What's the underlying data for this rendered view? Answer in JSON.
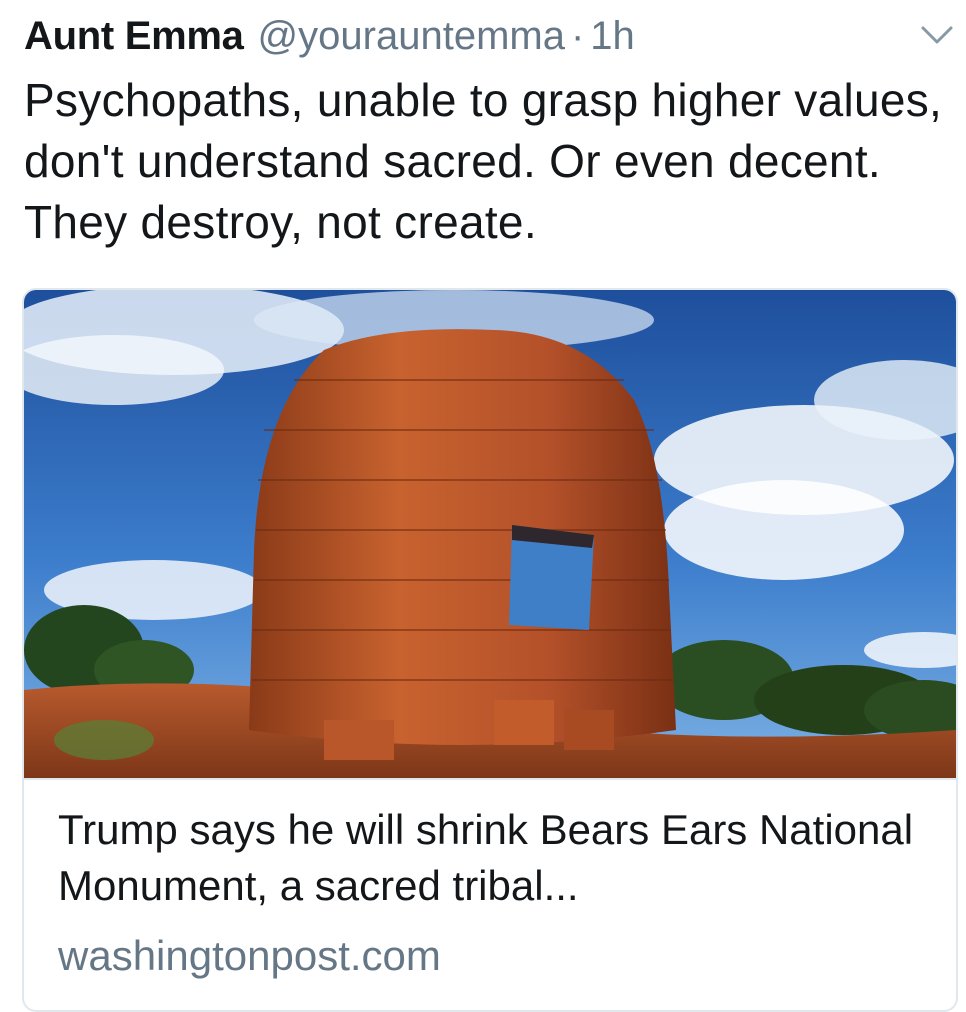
{
  "tweet": {
    "display_name": "Aunt Emma",
    "handle": "@yourauntemma",
    "separator": "·",
    "timestamp": "1h",
    "text": "Psychopaths, unable to grasp higher values, don't understand sacred. Or even decent. They destroy, not create.",
    "menu_icon": "chevron-down-icon"
  },
  "link_card": {
    "image_icon": "stone-tower-photo",
    "title": "Trump says he will shrink Bears Ears National Monument, a sacred tribal...",
    "domain": "washingtonpost.com"
  },
  "colors": {
    "text_primary": "#14171a",
    "text_secondary": "#657786",
    "card_border": "#e1e8ed",
    "sky": "#2f6bbd",
    "sandstone": "#b5532a"
  }
}
